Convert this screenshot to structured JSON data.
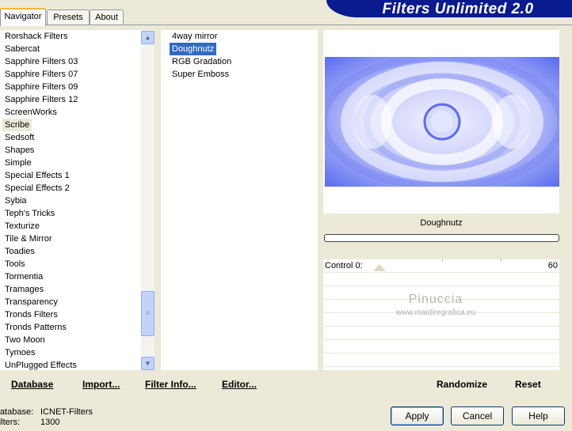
{
  "tabs": [
    "Navigator",
    "Presets",
    "About"
  ],
  "app_title": "Filters Unlimited 2.0",
  "categories": [
    "Rorshack Filters",
    "Sabercat",
    "Sapphire Filters 03",
    "Sapphire Filters 07",
    "Sapphire Filters 09",
    "Sapphire Filters 12",
    "ScreenWorks",
    "Scribe",
    "Sedsoft",
    "Shapes",
    "Simple",
    "Special Effects 1",
    "Special Effects 2",
    "Sybia",
    "Teph's Tricks",
    "Texturize",
    "Tile & Mirror",
    "Toadies",
    "Tools",
    "Tormentia",
    "Tramages",
    "Transparency",
    "Tronds Filters",
    "Tronds Patterns",
    "Two Moon",
    "Tymoes",
    "UnPlugged Effects"
  ],
  "selected_category": "Scribe",
  "filters": [
    "4way mirror",
    "Doughnutz",
    "RGB Gradation",
    "Super Emboss"
  ],
  "selected_filter": "Doughnutz",
  "preview": {
    "filter_name": "Doughnutz"
  },
  "controls": [
    {
      "label": "Control 0:",
      "value": "60",
      "level": 60,
      "max": 255
    }
  ],
  "watermark": {
    "name": "Pinuccia",
    "url": "www.maidiregrafica.eu"
  },
  "actions": {
    "database": "Database",
    "import": "Import...",
    "filter_info": "Filter Info...",
    "editor": "Editor...",
    "randomize": "Randomize",
    "reset": "Reset"
  },
  "footer": {
    "database_label": "Database:",
    "database_value": "ICNET-Filters",
    "filters_label": "Filters:",
    "filters_value": "1300",
    "apply": "Apply",
    "cancel": "Cancel",
    "help": "Help"
  },
  "colors": {
    "banner": "#0a1a8f",
    "selection": "#316ac5",
    "preview_blue": "#5b6df0"
  }
}
